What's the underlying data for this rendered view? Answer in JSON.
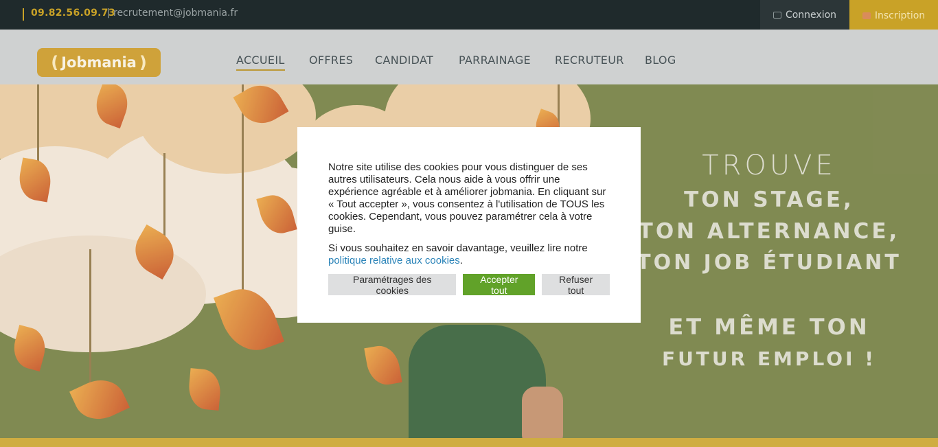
{
  "topbar": {
    "phone": "09.82.56.09.73",
    "separator": "|",
    "email": "recrutement@jobmania.fr",
    "login_label": "Connexion",
    "register_label": "Inscription"
  },
  "nav": {
    "logo_text": "Jobmania",
    "items": [
      {
        "label": "ACCUEIL",
        "active": true
      },
      {
        "label": "OFFRES"
      },
      {
        "label": "CANDIDAT"
      },
      {
        "label": "PARRAINAGE"
      },
      {
        "label": "RECRUTEUR"
      },
      {
        "label": "BLOG"
      }
    ]
  },
  "hero": {
    "line1": "TROUVE",
    "line2": "TON STAGE,",
    "line3": "TON ALTERNANCE,",
    "line4": "TON JOB ÉTUDIANT",
    "line5": "ET MÊME TON",
    "line6": "FUTUR EMPLOI !"
  },
  "cookie_modal": {
    "paragraph1": "Notre site utilise des cookies pour vous distinguer de ses autres utilisateurs. Cela nous aide à vous offrir une expérience agréable et à améliorer jobmania. En cliquant sur « Tout accepter », vous consentez à l'utilisation de TOUS les cookies. Cependant, vous pouvez paramétrer cela à votre guise.",
    "paragraph2_prefix": "Si vous souhaitez en savoir davantage, veuillez lire notre",
    "policy_link": "politique relative aux cookies",
    "paragraph2_suffix": ".",
    "settings_button": "Paramétrages des cookies",
    "accept_button": "Accepter tout",
    "reject_button": "Refuser tout"
  },
  "colors": {
    "brand_gold": "#c9a227",
    "topbar_bg": "#1f2a2c",
    "accept_green": "#61a229",
    "link_blue": "#2a83b8",
    "hero_olive": "#6f7a3b"
  }
}
